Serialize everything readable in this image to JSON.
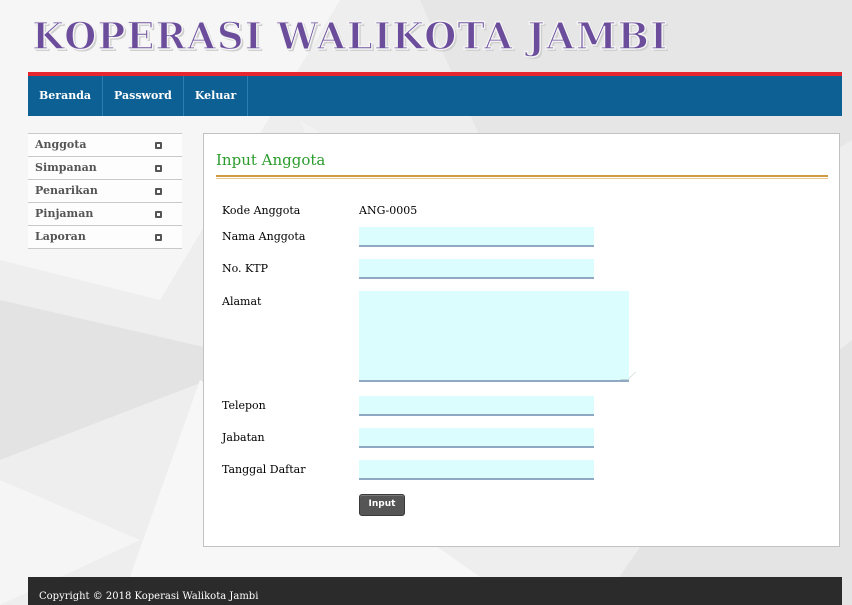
{
  "site": {
    "title": "KOPERASI WALIKOTA JAMBI",
    "title_color": "#6b4d9c"
  },
  "navbar": {
    "background_color": "#0d6094",
    "accent_color": "#e5262e",
    "items": [
      {
        "label": "Beranda"
      },
      {
        "label": "Password"
      },
      {
        "label": "Keluar"
      }
    ]
  },
  "sidebar": {
    "items": [
      {
        "label": "Anggota",
        "icon": "square-bullet-icon"
      },
      {
        "label": "Simpanan",
        "icon": "square-bullet-icon"
      },
      {
        "label": "Penarikan",
        "icon": "square-bullet-icon"
      },
      {
        "label": "Pinjaman",
        "icon": "square-bullet-icon"
      },
      {
        "label": "Laporan",
        "icon": "square-bullet-icon"
      }
    ]
  },
  "form": {
    "title": "Input Anggota",
    "title_color": "#2c9c2c",
    "input_background": "#dcfdfd",
    "kode_label": "Kode Anggota",
    "kode_value": "ANG-0005",
    "nama_label": "Nama Anggota",
    "nama_value": "",
    "ktp_label": "No. KTP",
    "ktp_value": "",
    "alamat_label": "Alamat",
    "alamat_value": "",
    "telepon_label": "Telepon",
    "telepon_value": "",
    "jabatan_label": "Jabatan",
    "jabatan_value": "",
    "tanggal_label": "Tanggal Daftar",
    "tanggal_value": "",
    "submit_label": "Input"
  },
  "footer": {
    "text": "Copyright © 2018 Koperasi Walikota Jambi",
    "background_color": "#2b2b2b"
  }
}
